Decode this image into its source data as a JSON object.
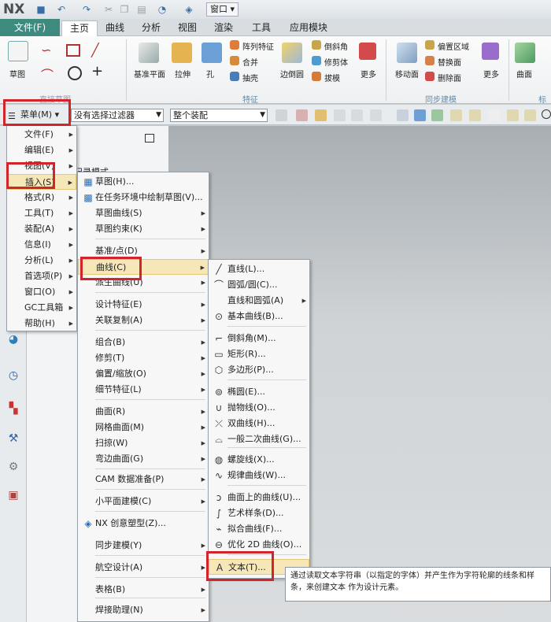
{
  "app": {
    "logo": "NX",
    "window_menu": "窗口",
    "window_menu_caret": "▾"
  },
  "tabs": [
    "文件(F)",
    "主页",
    "曲线",
    "分析",
    "视图",
    "渲染",
    "工具",
    "应用模块"
  ],
  "ribbon": {
    "sketch": "草图",
    "direct_sketch_group": "直接草图",
    "datum_plane": "基准平面",
    "extrude": "拉伸",
    "hole": "孔",
    "pattern_feature": "阵列特征",
    "unite": "合并",
    "shell": "抽壳",
    "edge_blend": "边倒圆",
    "chamfer": "倒斜角",
    "trim_body": "修剪体",
    "draft": "拔模",
    "more1": "更多",
    "feature_group": "特征",
    "move_face": "移动面",
    "offset_region": "偏置区域",
    "replace_face": "替换面",
    "delete_face": "删除面",
    "more2": "更多",
    "sync_group": "同步建模",
    "surface": "曲面",
    "more_short": "标"
  },
  "toolbar2": {
    "menu_button": "菜单(M)",
    "filter": "没有选择过滤器",
    "assembly": "整个装配"
  },
  "nav": {
    "record_mode": "记录模式"
  },
  "main_menu": [
    {
      "label": "文件(F)",
      "sub": "▶"
    },
    {
      "label": "编辑(E)",
      "sub": "▶"
    },
    {
      "label": "视图(V)",
      "sub": "▶"
    },
    {
      "label": "插入(S)",
      "sub": "▶"
    },
    {
      "label": "格式(R)",
      "sub": "▶"
    },
    {
      "label": "工具(T)",
      "sub": "▶"
    },
    {
      "label": "装配(A)",
      "sub": "▶"
    },
    {
      "label": "信息(I)",
      "sub": "▶"
    },
    {
      "label": "分析(L)",
      "sub": "▶"
    },
    {
      "label": "首选项(P)",
      "sub": "▶"
    },
    {
      "label": "窗口(O)",
      "sub": "▶"
    },
    {
      "label": "GC工具箱",
      "sub": "▶"
    },
    {
      "label": "帮助(H)",
      "sub": "▶"
    }
  ],
  "insert_menu": [
    {
      "label": "草图(H)...",
      "sub": ""
    },
    {
      "label": "在任务环境中绘制草图(V)...",
      "sub": ""
    },
    {
      "label": "草图曲线(S)",
      "sub": "▶"
    },
    {
      "label": "草图约束(K)",
      "sub": "▶"
    },
    {
      "label": "基准/点(D)",
      "sub": "▶"
    },
    {
      "label": "曲线(C)",
      "sub": "▶"
    },
    {
      "label": "派生曲线(U)",
      "sub": "▶"
    },
    {
      "label": "设计特征(E)",
      "sub": "▶"
    },
    {
      "label": "关联复制(A)",
      "sub": "▶"
    },
    {
      "label": "组合(B)",
      "sub": "▶"
    },
    {
      "label": "修剪(T)",
      "sub": "▶"
    },
    {
      "label": "偏置/缩放(O)",
      "sub": "▶"
    },
    {
      "label": "细节特征(L)",
      "sub": "▶"
    },
    {
      "label": "曲面(R)",
      "sub": "▶"
    },
    {
      "label": "网格曲面(M)",
      "sub": "▶"
    },
    {
      "label": "扫掠(W)",
      "sub": "▶"
    },
    {
      "label": "弯边曲面(G)",
      "sub": "▶"
    },
    {
      "label": "CAM 数据准备(P)",
      "sub": "▶"
    },
    {
      "label": "小平面建模(C)",
      "sub": "▶"
    },
    {
      "label": "NX 创意塑型(Z)...",
      "sub": ""
    },
    {
      "label": "同步建模(Y)",
      "sub": "▶"
    },
    {
      "label": "航空设计(A)",
      "sub": "▶"
    },
    {
      "label": "表格(B)",
      "sub": "▶"
    },
    {
      "label": "焊接助理(N)",
      "sub": "▶"
    }
  ],
  "curve_menu": [
    {
      "label": "直线(L)...",
      "sub": ""
    },
    {
      "label": "圆弧/圆(C)...",
      "sub": ""
    },
    {
      "label": "直线和圆弧(A)",
      "sub": "▶"
    },
    {
      "label": "基本曲线(B)...",
      "sub": ""
    },
    {
      "label": "倒斜角(M)...",
      "sub": ""
    },
    {
      "label": "矩形(R)...",
      "sub": ""
    },
    {
      "label": "多边形(P)...",
      "sub": ""
    },
    {
      "label": "椭圆(E)...",
      "sub": ""
    },
    {
      "label": "抛物线(O)...",
      "sub": ""
    },
    {
      "label": "双曲线(H)...",
      "sub": ""
    },
    {
      "label": "一般二次曲线(G)...",
      "sub": ""
    },
    {
      "label": "螺旋线(X)...",
      "sub": ""
    },
    {
      "label": "规律曲线(W)...",
      "sub": ""
    },
    {
      "label": "曲面上的曲线(U)...",
      "sub": ""
    },
    {
      "label": "艺术样条(D)...",
      "sub": ""
    },
    {
      "label": "拟合曲线(F)...",
      "sub": ""
    },
    {
      "label": "优化 2D 曲线(O)...",
      "sub": ""
    },
    {
      "label": "文本(T)...",
      "sub": ""
    }
  ],
  "tooltip": "通过读取文本字符串（以指定的字体）并产生作为字符轮廓的线条和样条，来创建文本 作为设计元素。",
  "colors": {
    "file_tab": "#3e8a7e",
    "highlight": "#f6e7b8",
    "red_box": "#d1242b"
  }
}
